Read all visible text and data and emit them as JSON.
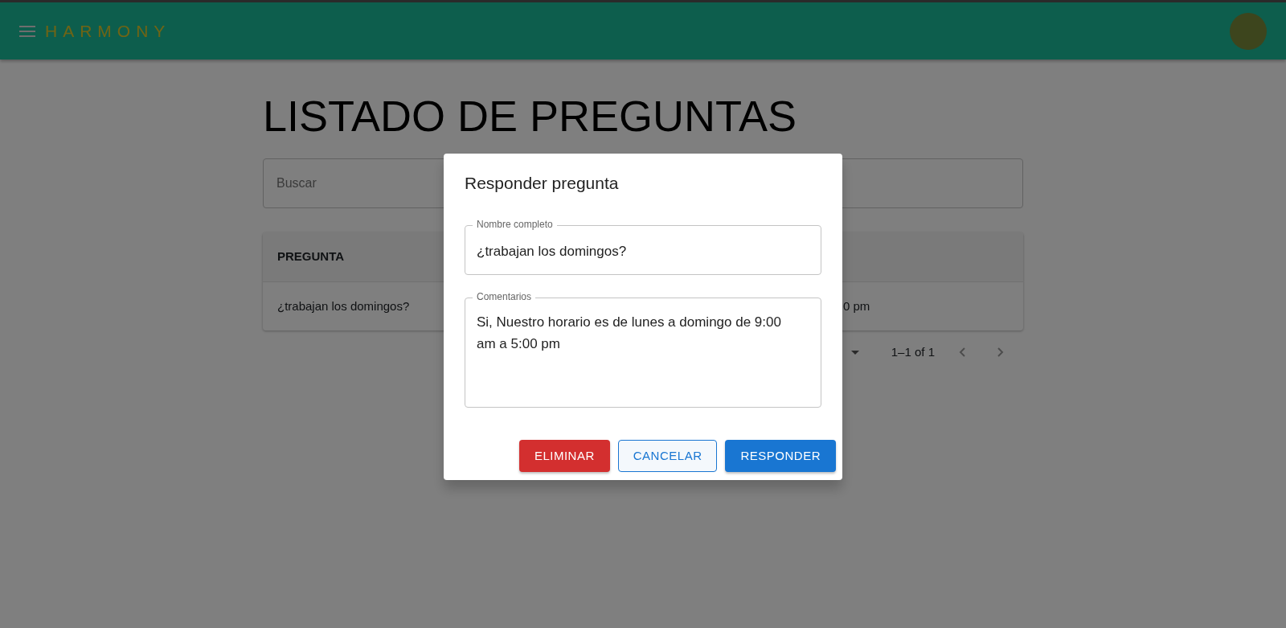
{
  "navbar": {
    "brand": "HARMONY"
  },
  "page": {
    "title": "LISTADO DE PREGUNTAS",
    "search": {
      "placeholder": "Buscar"
    }
  },
  "table": {
    "columns": [
      "PREGUNTA"
    ],
    "rows": [
      {
        "cells": [
          "¿trabajan los domingos?",
          "0 pm"
        ]
      }
    ]
  },
  "pagination": {
    "range": "1–1 of 1"
  },
  "dialog": {
    "title": "Responder pregunta",
    "fields": [
      {
        "kind": "input",
        "label": "Nombre completo",
        "value": "¿trabajan los domingos?"
      },
      {
        "kind": "textarea",
        "label": "Comentarios",
        "value": "Si, Nuestro horario es de lunes a domingo de 9:00 am a 5:00 pm"
      }
    ],
    "buttons": [
      {
        "kind": "danger",
        "label": "ELIMINAR"
      },
      {
        "kind": "outlined",
        "label": "CANCELAR"
      },
      {
        "kind": "primary",
        "label": "RESPONDER"
      }
    ]
  }
}
